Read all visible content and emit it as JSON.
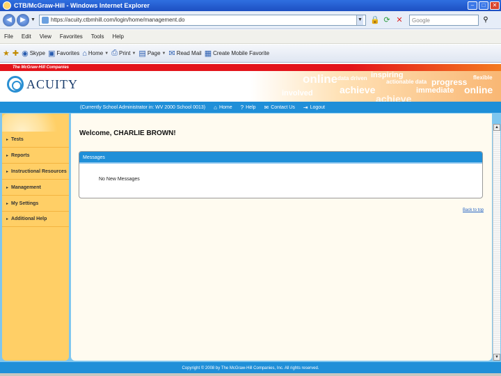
{
  "window": {
    "title": "CTB/McGraw-Hill - Windows Internet Explorer",
    "url": "https://acuity.ctbmhill.com/login/home/management.do",
    "search_placeholder": "Google"
  },
  "menu": [
    "File",
    "Edit",
    "View",
    "Favorites",
    "Tools",
    "Help"
  ],
  "toolbar": {
    "skype": "Skype",
    "favorites": "Favorites",
    "home": "Home",
    "print": "Print",
    "page": "Page",
    "read_mail": "Read Mail",
    "create_mobile": "Create Mobile Favorite"
  },
  "brand": {
    "company_bar": "The McGraw-Hill Companies",
    "logo": "ACUITY",
    "taglines": [
      "online",
      "data driven",
      "inspiring",
      "actionable data",
      "progress",
      "flexible",
      "achieve",
      "immediate",
      "online",
      "involved",
      "achieve"
    ]
  },
  "nav": {
    "user": "(Currently School Administrator in: WV 2000 School 0013)",
    "home": "Home",
    "help": "Help",
    "contact": "Contact Us",
    "logout": "Logout"
  },
  "sidebar": {
    "items": [
      {
        "label": "Tests"
      },
      {
        "label": "Reports"
      },
      {
        "label": "Instructional Resources"
      },
      {
        "label": "Management"
      },
      {
        "label": "My Settings"
      },
      {
        "label": "Additional Help"
      }
    ]
  },
  "main": {
    "welcome": "Welcome, CHARLIE BROWN!",
    "messages_title": "Messages",
    "messages_body": "No New Messages",
    "back_link": "Back to top"
  },
  "footer": {
    "copyright": "Copyright © 2008 by The McGraw-Hill Companies, Inc. All rights reserved."
  },
  "colors": {
    "accent_blue": "#1f8fd8",
    "sidebar_orange": "#ffcf66",
    "brand_red": "#e3141b"
  }
}
